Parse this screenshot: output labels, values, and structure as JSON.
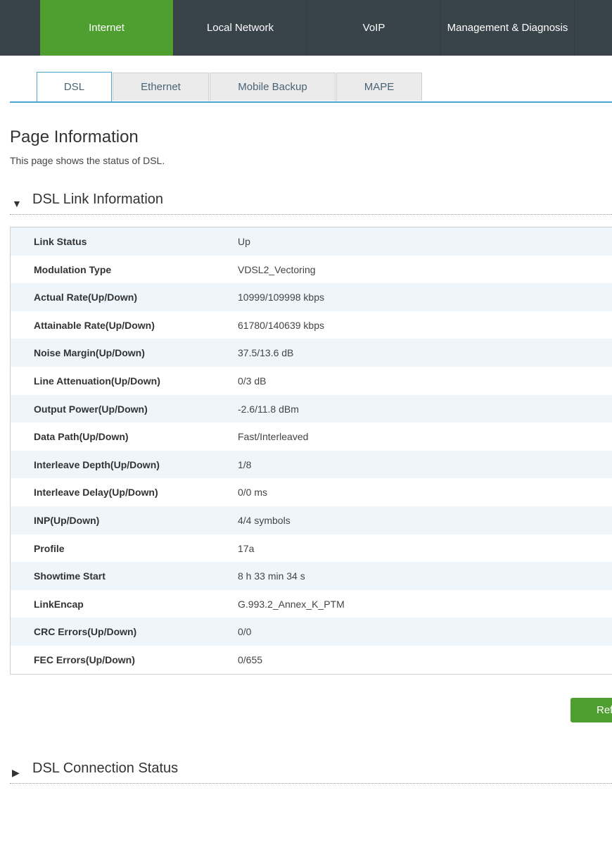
{
  "topnav": {
    "items": [
      {
        "label": "Internet",
        "active": true
      },
      {
        "label": "Local Network",
        "active": false
      },
      {
        "label": "VoIP",
        "active": false
      },
      {
        "label": "Management & Diagnosis",
        "active": false
      }
    ]
  },
  "subtabs": {
    "items": [
      {
        "label": "DSL",
        "active": true
      },
      {
        "label": "Ethernet",
        "active": false
      },
      {
        "label": "Mobile Backup",
        "active": false
      },
      {
        "label": "MAPE",
        "active": false
      }
    ]
  },
  "page": {
    "title": "Page Information",
    "description": "This page shows the status of DSL."
  },
  "sections": {
    "link_info": {
      "title": "DSL Link Information",
      "arrow": "▼",
      "rows": [
        {
          "label": "Link Status",
          "value": "Up"
        },
        {
          "label": "Modulation Type",
          "value": "VDSL2_Vectoring"
        },
        {
          "label": "Actual Rate(Up/Down)",
          "value": "10999/109998 kbps"
        },
        {
          "label": "Attainable Rate(Up/Down)",
          "value": "61780/140639 kbps"
        },
        {
          "label": "Noise Margin(Up/Down)",
          "value": "37.5/13.6 dB"
        },
        {
          "label": "Line Attenuation(Up/Down)",
          "value": "0/3 dB"
        },
        {
          "label": "Output Power(Up/Down)",
          "value": "-2.6/11.8 dBm"
        },
        {
          "label": "Data Path(Up/Down)",
          "value": "Fast/Interleaved"
        },
        {
          "label": "Interleave Depth(Up/Down)",
          "value": "1/8"
        },
        {
          "label": "Interleave Delay(Up/Down)",
          "value": "0/0 ms"
        },
        {
          "label": "INP(Up/Down)",
          "value": "4/4 symbols"
        },
        {
          "label": "Profile",
          "value": "17a"
        },
        {
          "label": "Showtime Start",
          "value": "8 h 33 min 34 s"
        },
        {
          "label": "LinkEncap",
          "value": "G.993.2_Annex_K_PTM"
        },
        {
          "label": "CRC Errors(Up/Down)",
          "value": "0/0"
        },
        {
          "label": "FEC Errors(Up/Down)",
          "value": "0/655"
        }
      ]
    },
    "connection_status": {
      "title": "DSL Connection Status",
      "arrow": "▶"
    }
  },
  "buttons": {
    "refresh_label": "Ref"
  },
  "colors": {
    "nav_bg": "#38434a",
    "accent_green": "#4e9f2f",
    "tab_blue": "#4aa6cf",
    "row_alt": "#eef6fc"
  }
}
